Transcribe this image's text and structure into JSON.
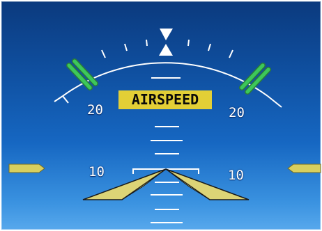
{
  "display": {
    "alert_text": "AIRSPEED",
    "pitch_labels": {
      "upper_left": "20",
      "upper_right": "20",
      "lower_left": "10",
      "lower_right": "10"
    }
  },
  "colors": {
    "sky_top": "#0b3a7e",
    "sky_bottom": "#57a8ec",
    "alert_background": "#e3cf36",
    "alert_text": "#0a0a0a",
    "scale_lines": "#ffffff",
    "bank_limit_marks": "#3cc85a",
    "aircraft_symbol": "#dcd476"
  }
}
